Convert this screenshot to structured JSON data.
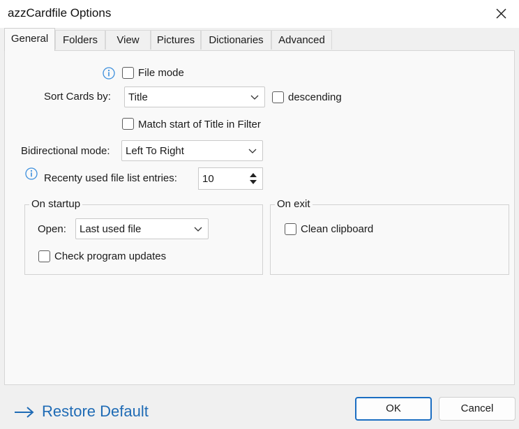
{
  "window": {
    "title": "azzCardfile Options"
  },
  "tabs": [
    {
      "label": "General",
      "active": true
    },
    {
      "label": "Folders"
    },
    {
      "label": "View"
    },
    {
      "label": "Pictures"
    },
    {
      "label": "Dictionaries"
    },
    {
      "label": "Advanced"
    }
  ],
  "general": {
    "file_mode_label": "File mode",
    "sort_label": "Sort Cards by:",
    "sort_value": "Title",
    "descending_label": "descending",
    "match_label": "Match start of Title in Filter",
    "bidi_label": "Bidirectional mode:",
    "bidi_value": "Left To Right",
    "recent_label": "Recenty used file list entries:",
    "recent_value": "10"
  },
  "startup": {
    "title": "On startup",
    "open_label": "Open:",
    "open_value": "Last used file",
    "check_updates_label": "Check program updates"
  },
  "exit": {
    "title": "On exit",
    "clean_clipboard_label": "Clean clipboard"
  },
  "footer": {
    "restore_label": "Restore Default",
    "ok_label": "OK",
    "cancel_label": "Cancel"
  },
  "colors": {
    "accent": "#1b6ec2",
    "info_icon": "#3c8fdd",
    "link": "#1f6bb5"
  }
}
